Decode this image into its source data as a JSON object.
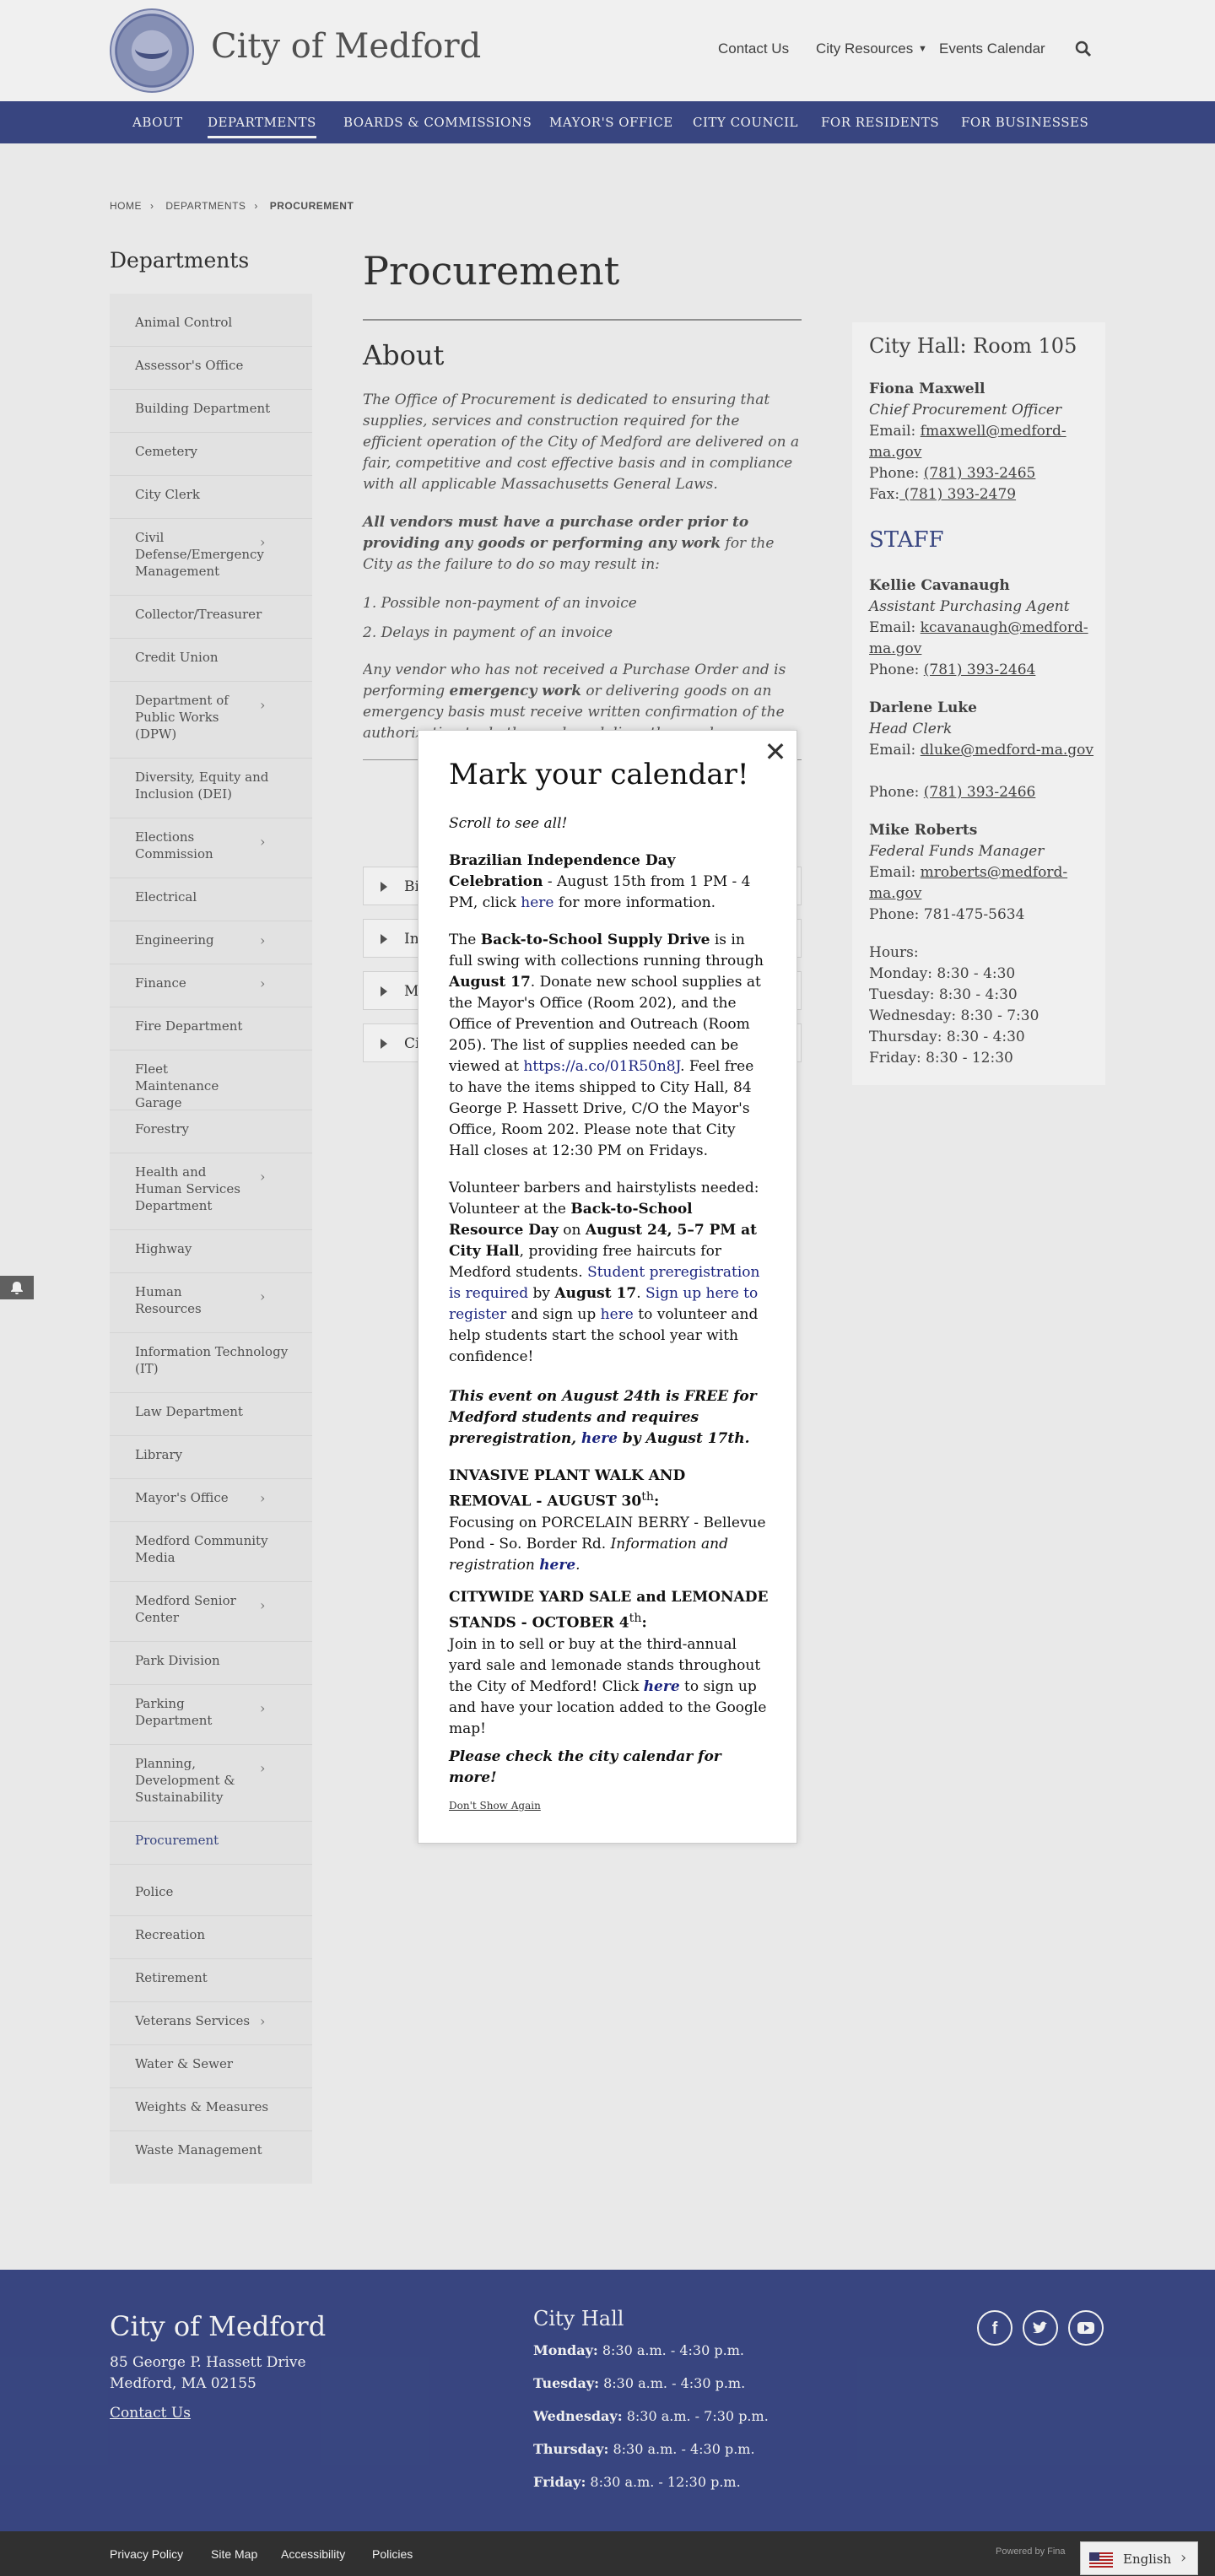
{
  "header": {
    "site_title": "City of Medford",
    "contact_us": "Contact Us",
    "city_resources": "City Resources",
    "events_calendar": "Events Calendar"
  },
  "mainnav": [
    "ABOUT",
    "DEPARTMENTS",
    "BOARDS & COMMISSIONS",
    "MAYOR'S OFFICE",
    "CITY COUNCIL",
    "FOR RESIDENTS",
    "FOR BUSINESSES"
  ],
  "breadcrumb": [
    "HOME",
    "DEPARTMENTS",
    "PROCUREMENT"
  ],
  "sidebar": {
    "title": "Departments",
    "items": [
      "Animal Control",
      "Assessor's Office",
      "Building Department",
      "Cemetery",
      "City Clerk",
      "Civil Defense/Emergency Management",
      "Collector/Treasurer",
      "Credit Union",
      "Department of Public Works (DPW)",
      "Diversity, Equity and Inclusion (DEI)",
      "Elections Commission",
      "Electrical",
      "Engineering",
      "Finance",
      "Fire Department",
      "Fleet Maintenance Garage",
      "Forestry",
      "Health and Human Services Department",
      "Highway",
      "Human Resources",
      "Information Technology (IT)",
      "Law Department",
      "Library",
      "Mayor's Office",
      "Medford Community Media",
      "Medford Senior Center",
      "Park Division",
      "Parking Department",
      "Planning, Development & Sustainability",
      "Procurement",
      "Police",
      "Recreation",
      "Retirement",
      "Veterans Services",
      "Water & Sewer",
      "Weights & Measures",
      "Waste Management"
    ]
  },
  "content": {
    "title": "Procurement",
    "about_heading": "About",
    "p1": "The Office of Procurement is dedicated to ensuring that supplies, services and construction required for the efficient operation of the City of Medford are delivered on a fair, competitive and cost effective basis and in compliance with all applicable Massachusetts General Laws.",
    "p2_bold": "All vendors must have a purchase order prior to providing any goods or performing any work",
    "p2_rest": " for the City as the failure to do so may result in:",
    "li1": "1. Possible non-payment of an invoice",
    "li2": "2. Delays in payment of an invoice",
    "p3_a": "Any vendor who has not received a Purchase Order and is performing ",
    "p3_bold": "emergency work",
    "p3_b": " or delivering goods on an emergency basis must receive written confirmation of the authorization to do the work or deliver the goods.",
    "accordions": [
      "Bi",
      "In",
      "M",
      "Ci"
    ]
  },
  "card": {
    "heading": "City Hall: Room 105",
    "p1_name": "Fiona Maxwell",
    "p1_title": "Chief Procurement Officer",
    "p1_email_label": "Email: ",
    "p1_email": "fmaxwell@medford-ma.gov",
    "p1_phone_label": "Phone: ",
    "p1_phone": "(781) 393-2465",
    "p1_fax_label": "Fax:",
    "p1_fax": " (781) 393-2479",
    "staff_heading": "STAFF",
    "p2_name": "Kellie Cavanaugh",
    "p2_title": "Assistant Purchasing Agent",
    "p2_email": "kcavanaugh@medford-ma.gov",
    "p2_phone": "(781) 393-2464",
    "p3_name": "Darlene Luke",
    "p3_title": "Head Clerk",
    "p3_email": "dluke@medford-ma.gov",
    "p3_phone": "(781) 393-2466",
    "p4_name": "Mike Roberts",
    "p4_title": "Federal Funds Manager",
    "p4_email": "mroberts@medford-ma.gov",
    "p4_phone": "781-475-5634",
    "hours_label": "Hours:",
    "hours": [
      "Monday: 8:30 - 4:30",
      "Tuesday: 8:30 - 4:30",
      "Wednesday: 8:30 - 7:30",
      "Thursday: 8:30 - 4:30",
      "Friday: 8:30 - 12:30"
    ]
  },
  "modal": {
    "title": "Mark your calendar!",
    "scroll": "Scroll to see all!",
    "b1_bold": "Brazilian Independence Day Celebration",
    "b1_a": " - August 15th from 1 PM - 4 PM, click ",
    "b1_link": "here",
    "b1_b": " for more information.",
    "b2_a": "The ",
    "b2_bold1": "Back-to-School Supply Drive",
    "b2_b": " is in full swing with collections running through ",
    "b2_bold2": "August 17",
    "b2_c": ". Donate new school supplies at the Mayor's Office (Room 202), and the Office of Prevention and Outreach (Room 205).  The list of supplies needed can be viewed at ",
    "b2_link": "https://a.co/01R50n8J",
    "b2_d": ".  Feel free to have the items shipped to City Hall, 84 George P. Hassett Drive, C/O the Mayor's Office, Room 202.  Please note that City Hall closes at 12:30 PM on Fridays.",
    "b3_a": "Volunteer barbers and hairstylists needed: Volunteer at the ",
    "b3_bold1": "Back-to-School Resource Day",
    "b3_b": " on ",
    "b3_bold2": "August 24, 5–7 PM at City Hall",
    "b3_c": ", providing free haircuts for Medford students. ",
    "b3_link1": "Student preregistration is required ",
    "b3_d": "by ",
    "b3_bold3": "August 17",
    "b3_e": ". ",
    "b3_link2": "Sign up here to register",
    "b3_f": " and sign up ",
    "b3_link3": "here",
    "b3_g": " to volunteer and help students start the school year with confidence!",
    "b4_a": "This event on August 24th is FREE for Medford students and requires preregistration, ",
    "b4_link": "here",
    "b4_b": " by August 17th.",
    "b5_bold": "INVASIVE PLANT WALK AND REMOVAL - AUGUST 30",
    "b5_sup": "th",
    "b5_colon": ":",
    "b5_a": "Focusing on PORCELAIN BERRY - Bellevue Pond - So. Border Rd. ",
    "b5_it": "Information and registration ",
    "b5_link": "here",
    "b5_dot": ".",
    "b6_bold": "CITYWIDE YARD SALE and LEMONADE STANDS - OCTOBER 4",
    "b6_sup": "th",
    "b6_colon": ":",
    "b6_a": "Join in to sell or buy at the third-annual yard sale and lemonade stands throughout the City of Medford!  Click ",
    "b6_link": "here",
    "b6_b": " to sign up and have your location added to the Google map!",
    "b7": "Please check the city calendar for more!",
    "dont_show": "Don't Show Again"
  },
  "footer": {
    "title": "City of Medford",
    "addr1": "85 George P. Hassett Drive",
    "addr2": "Medford, MA  02155",
    "contact": "Contact Us",
    "hall": "City Hall",
    "hours": [
      {
        "day": "Monday:",
        "time": " 8:30 a.m. - 4:30 p.m."
      },
      {
        "day": "Tuesday:",
        "time": " 8:30 a.m. - 4:30 p.m."
      },
      {
        "day": "Wednesday:",
        "time": " 8:30 a.m. - 7:30 p.m."
      },
      {
        "day": "Thursday:",
        "time": " 8:30 a.m. - 4:30 p.m."
      },
      {
        "day": "Friday:",
        "time": " 8:30 a.m. - 12:30 p.m."
      }
    ],
    "links": [
      "Privacy Policy",
      "Site Map",
      "Accessibility",
      "Policies"
    ],
    "powered": "Powered by Fina",
    "language": "English"
  }
}
